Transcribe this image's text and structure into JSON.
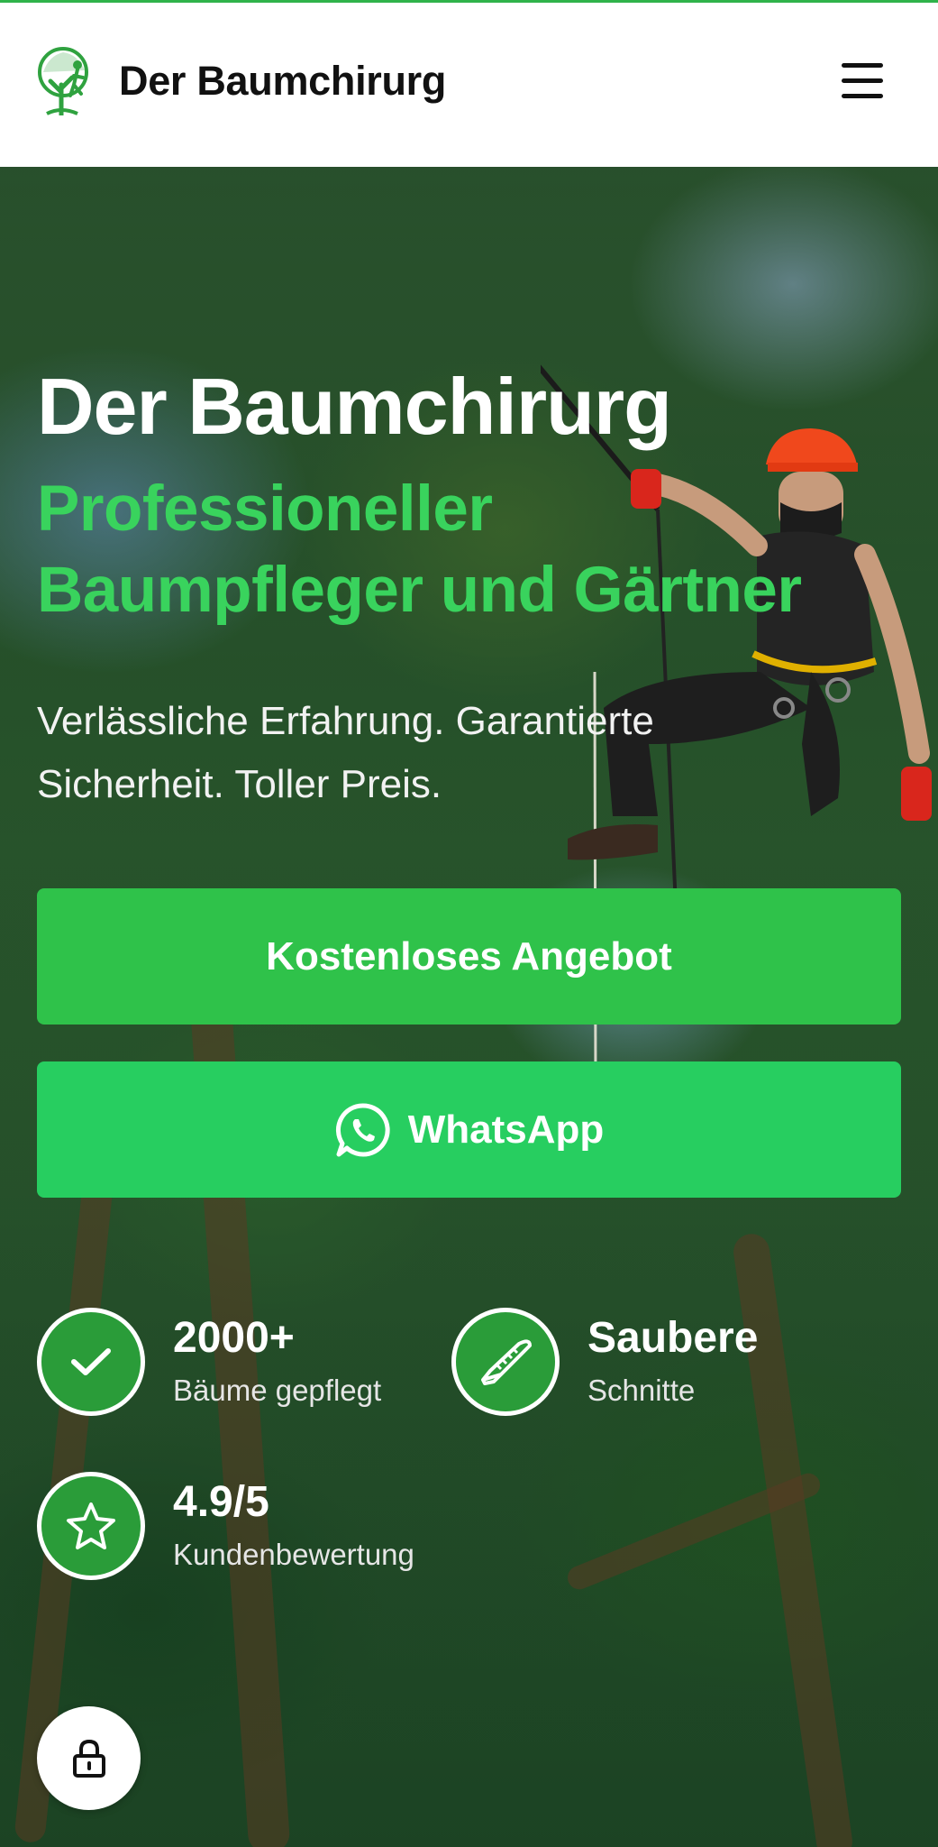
{
  "header": {
    "brand": "Der Baumchirurg",
    "logo_icon": "tree-climber-logo-icon",
    "menu_icon": "hamburger-menu-icon"
  },
  "hero": {
    "title": "Der Baumchirurg",
    "subtitle_line1": "Professioneller",
    "subtitle_line2": "Baumpfleger und Gärtner",
    "tagline_line1": "Verlässliche Erfahrung. Garantierte",
    "tagline_line2": "Sicherheit. Toller Preis.",
    "cta_quote": "Kostenloses Angebot",
    "cta_whatsapp": "WhatsApp"
  },
  "stats": [
    {
      "value": "2000+",
      "label": "Bäume gepflegt",
      "icon": "checkmark-icon"
    },
    {
      "value": "Saubere",
      "label": "Schnitte",
      "icon": "saw-icon"
    },
    {
      "value": "4.9/5",
      "label": "Kundenbewertung",
      "icon": "star-icon"
    }
  ],
  "colors": {
    "accent_green": "#39d35d",
    "button_green": "#2fc24a",
    "whatsapp_green": "#27ce60",
    "stat_circle": "#2a9c39"
  },
  "floating": {
    "icon": "lock-icon"
  }
}
